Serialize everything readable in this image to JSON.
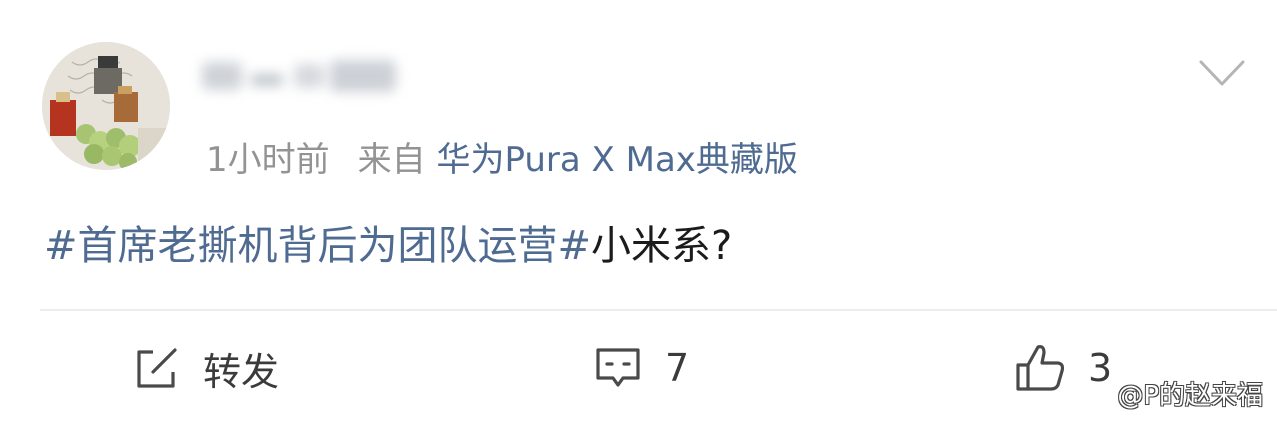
{
  "post": {
    "time": "1小时前",
    "source_prefix": "来自",
    "device": "华为Pura X Max典藏版",
    "topic": "#首席老撕机背后为团队运营#",
    "body": "小米系?"
  },
  "actions": {
    "repost_label": "转发",
    "comment_count": "7",
    "like_count": "3"
  },
  "watermark": "@P的赵来福",
  "colors": {
    "link_blue": "#4f6b91",
    "meta_gray": "#939393",
    "text": "#1b1b1b",
    "icon_gray": "#4a4a4a"
  },
  "icons": {
    "repost": "edit-square-icon",
    "comment": "comment-bubble-icon",
    "like": "thumbs-up-icon",
    "more": "chevron-down-icon"
  }
}
